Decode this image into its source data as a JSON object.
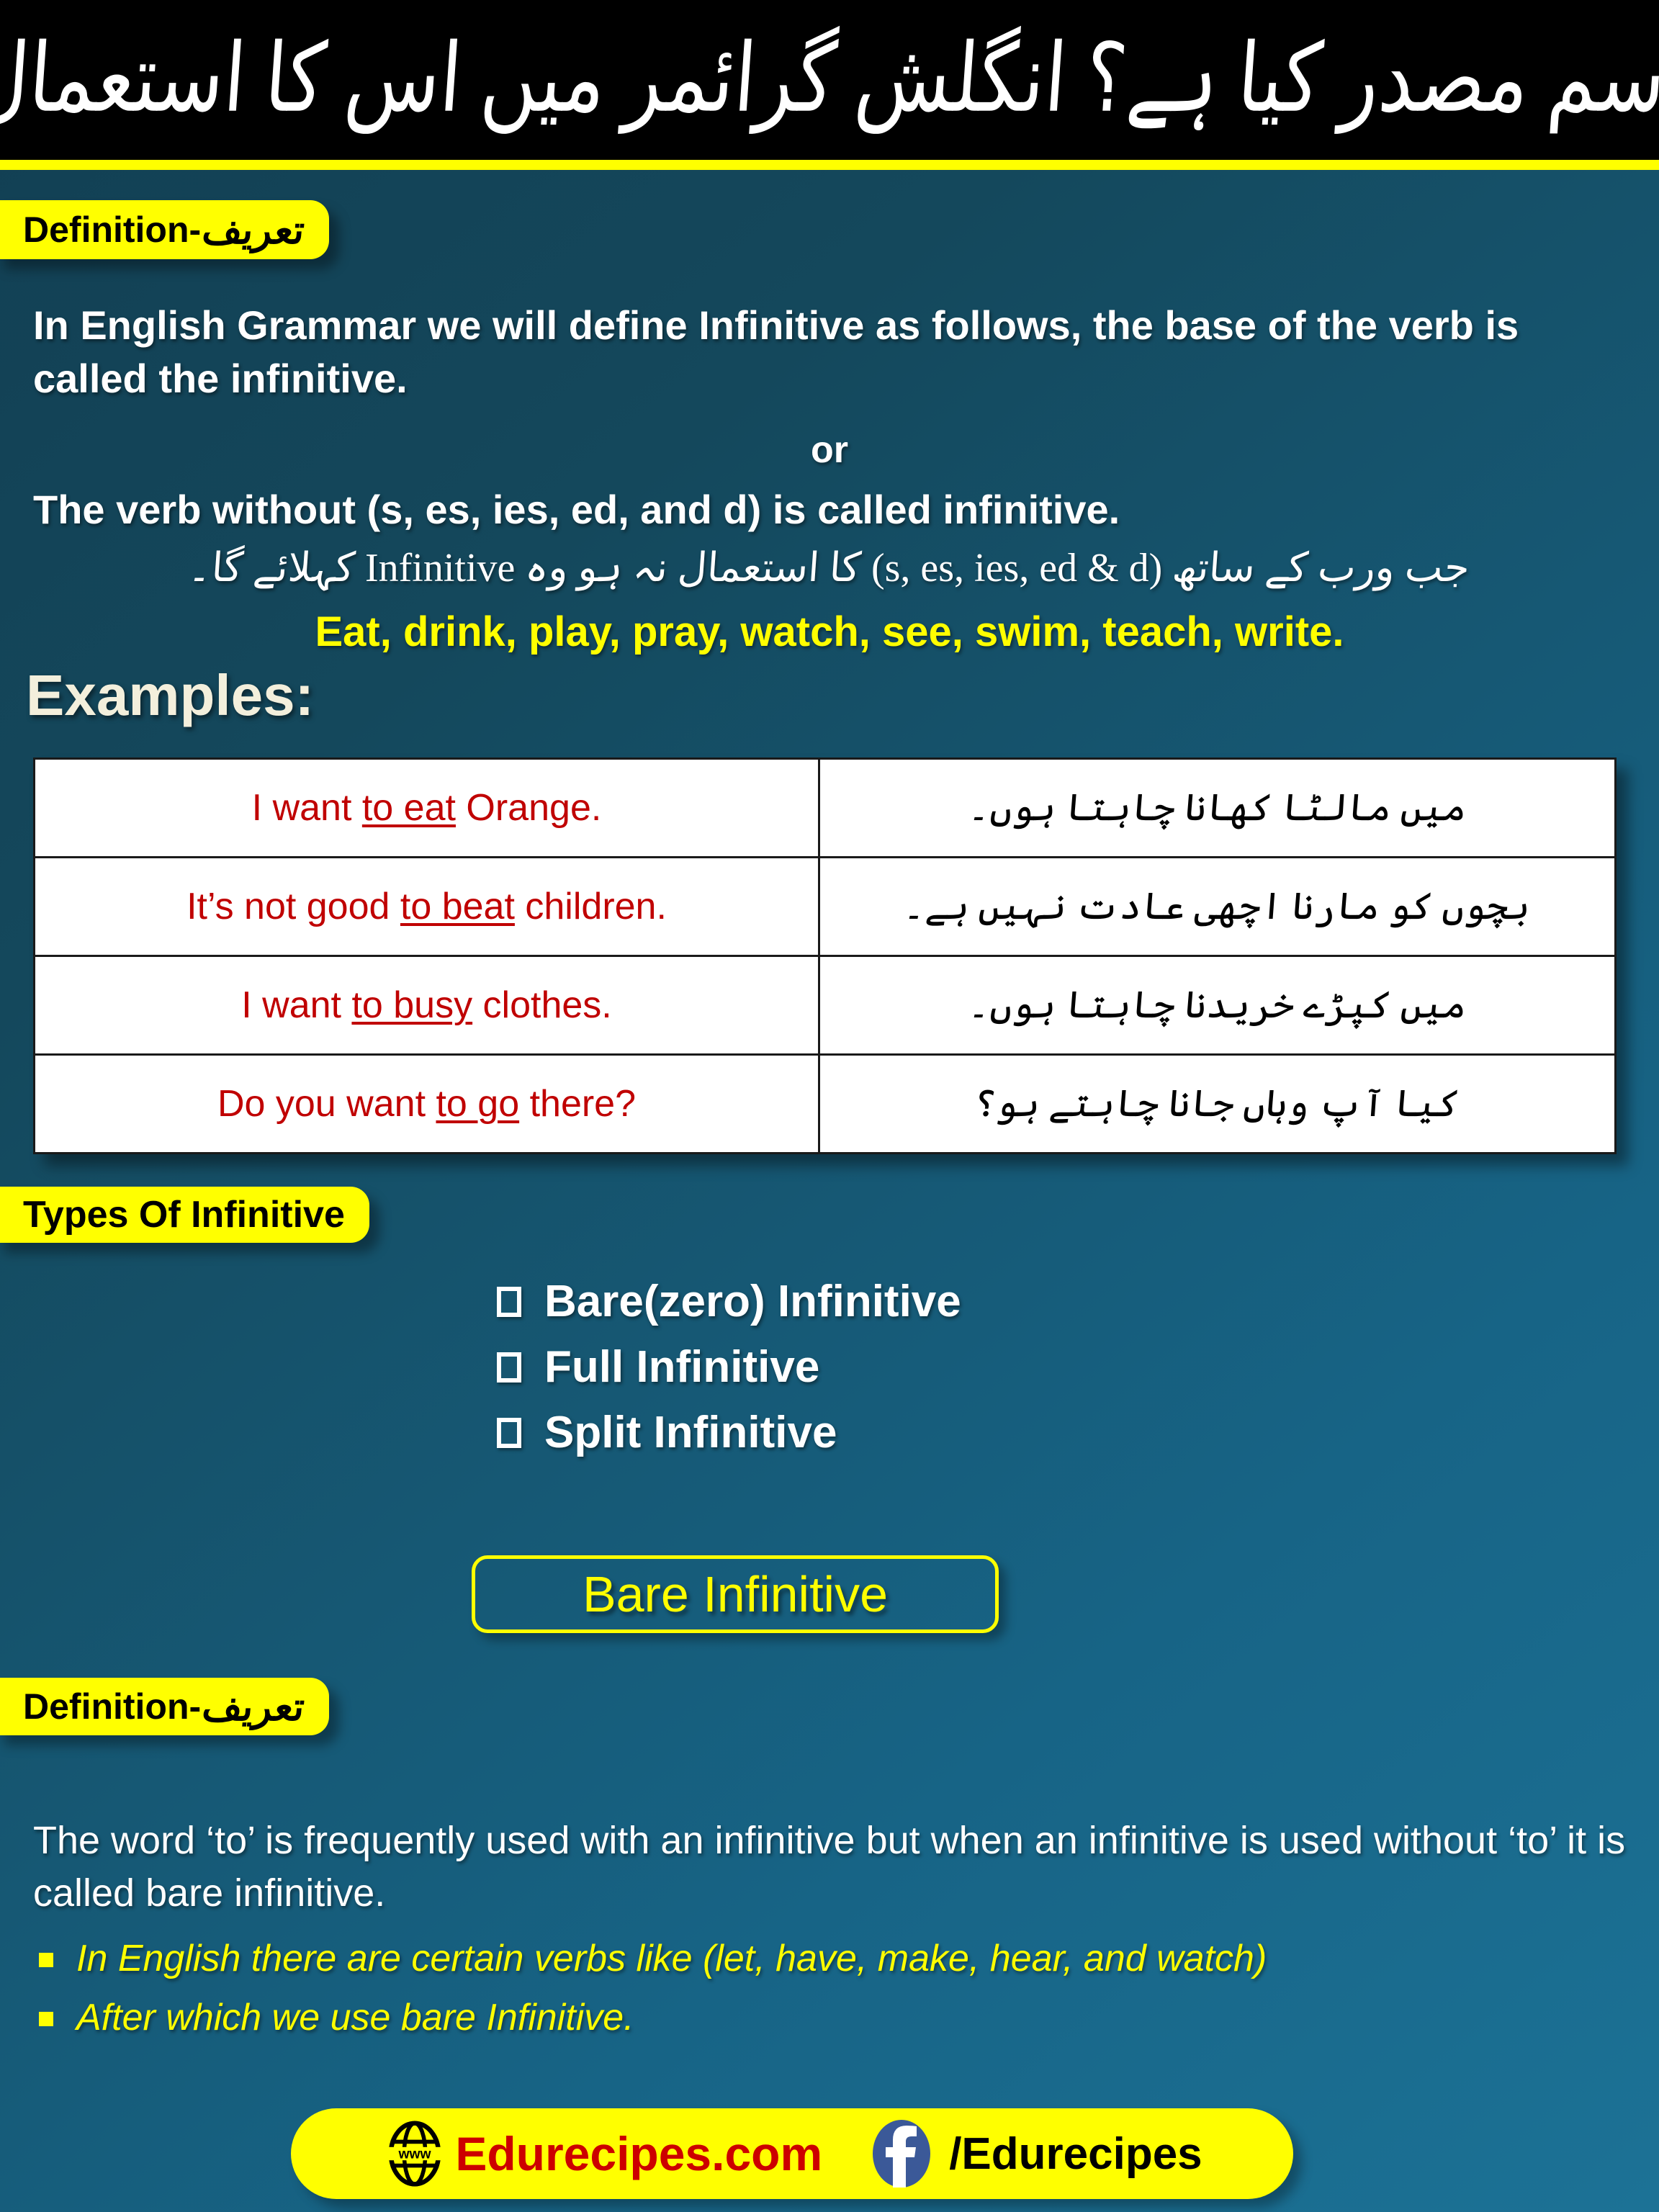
{
  "colors": {
    "bg_top": "#14485C",
    "bg_bottom": "#1C7296",
    "accent_yellow": "#FFFF00",
    "title_band": "#000000",
    "example_red": "#C00000",
    "examples_heading": "#F3EFDC",
    "facebook_blue": "#3B5998",
    "site_red": "#CC0000"
  },
  "title": {
    "urdu": "اسم مصدر کیا ہے؟ انگلش گرائمر میں اس کا استعمال"
  },
  "definition_section": {
    "badge_en": "Definition-",
    "badge_ur": "تعریف",
    "paragraph_1": "In English Grammar  we will define Infinitive  as follows, the base of the verb is called the infinitive.",
    "or_label": "or",
    "paragraph_2": "The verb without (s, es, ies, ed, and d) is called infinitive.",
    "urdu_line_part1": "جب ورب کے ساتھ",
    "urdu_line_en1": "(s,  es, ies, ed & d)",
    "urdu_line_part2": "کا استعمال نہ ہو وہ",
    "urdu_line_en2": "Infinitive",
    "urdu_line_part3": "کہلائے گا۔",
    "verb_examples": "Eat, drink, play, pray, watch, see, swim, teach, write."
  },
  "examples": {
    "heading": "Examples:",
    "rows": [
      {
        "english_before": "I want ",
        "english_underlined": "to eat",
        "english_after": " Orange.",
        "urdu": "میں مالٹا کھانا چاہتا ہوں۔"
      },
      {
        "english_before": "It’s not good ",
        "english_underlined": "to beat",
        "english_after": " children.",
        "urdu": "بچوں کو مارنا اچھی عادت نہیں ہے۔"
      },
      {
        "english_before": "I want ",
        "english_underlined": "to busy",
        "english_after": " clothes.",
        "urdu": "میں کپڑے خریدنا چاہتا ہوں۔"
      },
      {
        "english_before": "Do you want ",
        "english_underlined": "to go",
        "english_after": " there?",
        "urdu": "کیا آپ وہاں جانا چاہتے ہو؟"
      }
    ]
  },
  "types_section": {
    "badge": "Types Of Infinitive",
    "items": [
      {
        "label": "Bare(zero) Infinitive"
      },
      {
        "label": "Full Infinitive"
      },
      {
        "label": "Split Infinitive"
      }
    ]
  },
  "bare_section": {
    "title": "Bare Infinitive",
    "badge_en": "Definition-",
    "badge_ur": "تعریف",
    "paragraph": "The word ‘to’ is frequently used with an infinitive but when an infinitive is used without ‘to’ it is called bare infinitive.",
    "bullets": [
      {
        "text": "In English there are certain verbs like (let, have, make, hear, and watch)"
      },
      {
        "text": "After which we use bare Infinitive."
      }
    ]
  },
  "footer": {
    "website": "Edurecipes.com",
    "globe_label": "www",
    "facebook_handle": "/Edurecipes"
  }
}
